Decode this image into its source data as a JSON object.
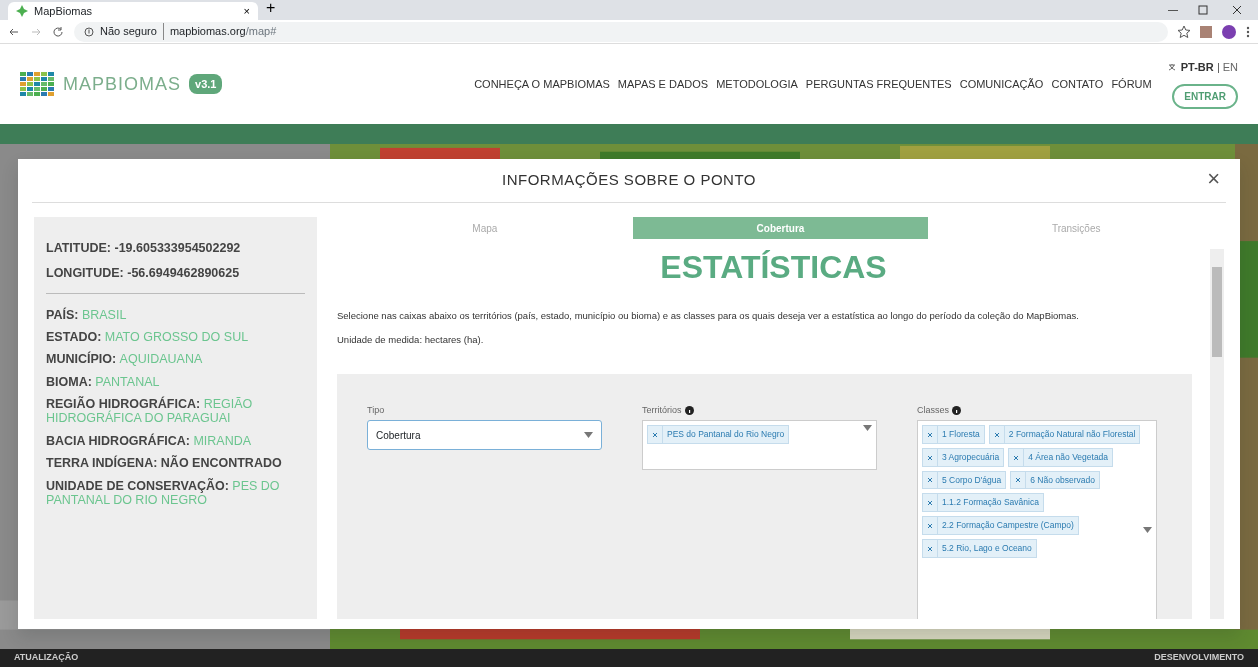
{
  "browser": {
    "tab_title": "MapBiomas",
    "new_tab": "+",
    "close_tab": "×",
    "security": "Não seguro",
    "url_host": "mapbiomas.org",
    "url_path": "/map#"
  },
  "site": {
    "logo_text": "MAPBIOMAS",
    "version": "v3.1",
    "nav": [
      {
        "label": "CONHEÇA O MAPBIOMAS"
      },
      {
        "label": "MAPAS E DADOS"
      },
      {
        "label": "METODOLOGIA"
      },
      {
        "label": "PERGUNTAS FREQUENTES"
      },
      {
        "label": "COMUNICAÇÃO"
      },
      {
        "label": "CONTATO"
      },
      {
        "label": "FÓRUM"
      }
    ],
    "languages": [
      {
        "label": "PT-BR",
        "selected": true
      },
      {
        "label": "EN",
        "selected": false
      }
    ],
    "login": "ENTRAR"
  },
  "modal": {
    "title": "INFORMAÇÕES SOBRE O PONTO",
    "close": "×",
    "coordinates": [
      {
        "label": "LATITUDE:",
        "value": "-19.605333954502292"
      },
      {
        "label": "LONGITUDE:",
        "value": "-56.6949462890625"
      }
    ],
    "details": [
      {
        "label": "PAÍS:",
        "value": "BRASIL",
        "found": true
      },
      {
        "label": "ESTADO:",
        "value": "MATO GROSSO DO SUL",
        "found": true
      },
      {
        "label": "MUNICÍPIO:",
        "value": "AQUIDAUANA",
        "found": true
      },
      {
        "label": "BIOMA:",
        "value": "PANTANAL",
        "found": true
      },
      {
        "label": "REGIÃO HIDROGRÁFICA:",
        "value": "REGIÃO HIDROGRÁFICA DO PARAGUAI",
        "found": true
      },
      {
        "label": "BACIA HIDROGRÁFICA:",
        "value": "MIRANDA",
        "found": true
      },
      {
        "label": "TERRA INDÍGENA:",
        "value": "NÃO ENCONTRADO",
        "found": false
      },
      {
        "label": "UNIDADE DE CONSERVAÇÃO:",
        "value": "PES DO PANTANAL DO RIO NEGRO",
        "found": true
      }
    ],
    "tabs": [
      {
        "label": "Mapa",
        "selected": false
      },
      {
        "label": "Cobertura",
        "selected": true
      },
      {
        "label": "Transições",
        "selected": false
      }
    ],
    "heading": "ESTATÍSTICAS",
    "description": "Selecione nas caixas abaixo os territórios (país, estado, município ou bioma) e as classes para os quais deseja ver a estatística ao longo do período da coleção do MapBiomas.",
    "unit_note": "Unidade de medida: hectares (ha).",
    "type_field": {
      "label": "Tipo",
      "value": "Cobertura"
    },
    "territories_field": {
      "label": "Territórios",
      "tags": [
        "PES do Pantanal do Rio Negro"
      ]
    },
    "classes_field": {
      "label": "Classes",
      "tags": [
        "1 Floresta",
        "2 Formação Natural não Florestal",
        "3 Agropecuária",
        "4 Área não Vegetada",
        "5 Corpo D'água",
        "6 Não observado",
        "1.1.2 Formação Savânica",
        "2.2 Formação Campestre (Campo)",
        "5.2 Rio, Lago e Oceano"
      ]
    }
  },
  "footer": {
    "left": "ATUALIZAÇÃO",
    "right": "DESENVOLVIMENTO"
  }
}
